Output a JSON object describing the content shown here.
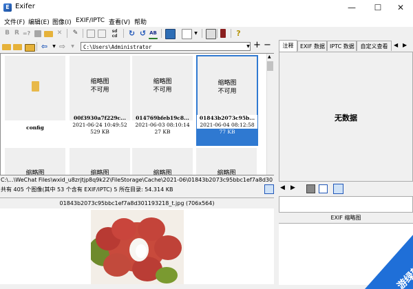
{
  "window": {
    "title": "Exifer",
    "icon": "exifer-app-icon"
  },
  "window_controls": {
    "minimize": "—",
    "maximize": "☐",
    "close": "✕"
  },
  "menu": [
    "文件(F)",
    "编辑(E)",
    "图像(I)",
    "EXIF/IPTC",
    "查看(V)",
    "帮助"
  ],
  "toolbar1_icons": [
    "bold-icon",
    "r-icon",
    "query-icon",
    "stop-icon",
    "open-folder-icon",
    "delete-icon",
    "edit-icon",
    "copy-icon",
    "move-icon",
    "sd-card-icon",
    "rotate-left-icon",
    "rotate-right-icon",
    "ab-text-icon",
    "image-icon",
    "view-menu-icon",
    "export-icon",
    "flash-icon",
    "help-icon"
  ],
  "nav": {
    "path": "C:\\Users\\Administrator",
    "back_icon": "back-arrow-icon",
    "forward_icon": "forward-arrow-icon"
  },
  "thumbnails": [
    {
      "name": "config",
      "type": "folder",
      "date": "",
      "size": ""
    },
    {
      "name": "00f3930a7f229c...",
      "placeholder": "缩略图\n不可用",
      "date": "2021-06-24 10:49:52",
      "size": "529 KB"
    },
    {
      "name": "014769bfeb19c8...",
      "placeholder": "缩略图\n不可用",
      "date": "2021-06-03 08:10:14",
      "size": "27 KB"
    },
    {
      "name": "01843b2073c95b...",
      "placeholder": "缩略图\n不可用",
      "date": "2021-06-04 08:12:58",
      "size": "77 KB",
      "selected": true
    }
  ],
  "second_row_placeholder": "缩略图",
  "placeholder_lines": [
    "缩略图",
    "不可用"
  ],
  "status": {
    "path": "C:\\...\\WeChat Files\\wxid_u8zrjtjp8q9k22\\FileStorage\\Cache\\2021-06\\01843b2073c95bbc1ef7a8d30",
    "count": "共有 405 个图像(其中 53 个含有 EXIF/IPTC) 5 所在目录: 54.314 KB"
  },
  "preview": {
    "caption": "01843b2073c95bbc1ef7a8d301193218_t.jpg (706x564)"
  },
  "tabs": [
    "注释",
    "EXIF 数据",
    "IPTC 数据",
    "自定义查看"
  ],
  "info": {
    "no_data": "无数据"
  },
  "exif_thumb": {
    "label": "EXIF 缩略图"
  },
  "watermark": {
    "text": "游绿软件"
  },
  "colors": {
    "selection": "#2f79d1",
    "accent": "#2f79d1"
  }
}
